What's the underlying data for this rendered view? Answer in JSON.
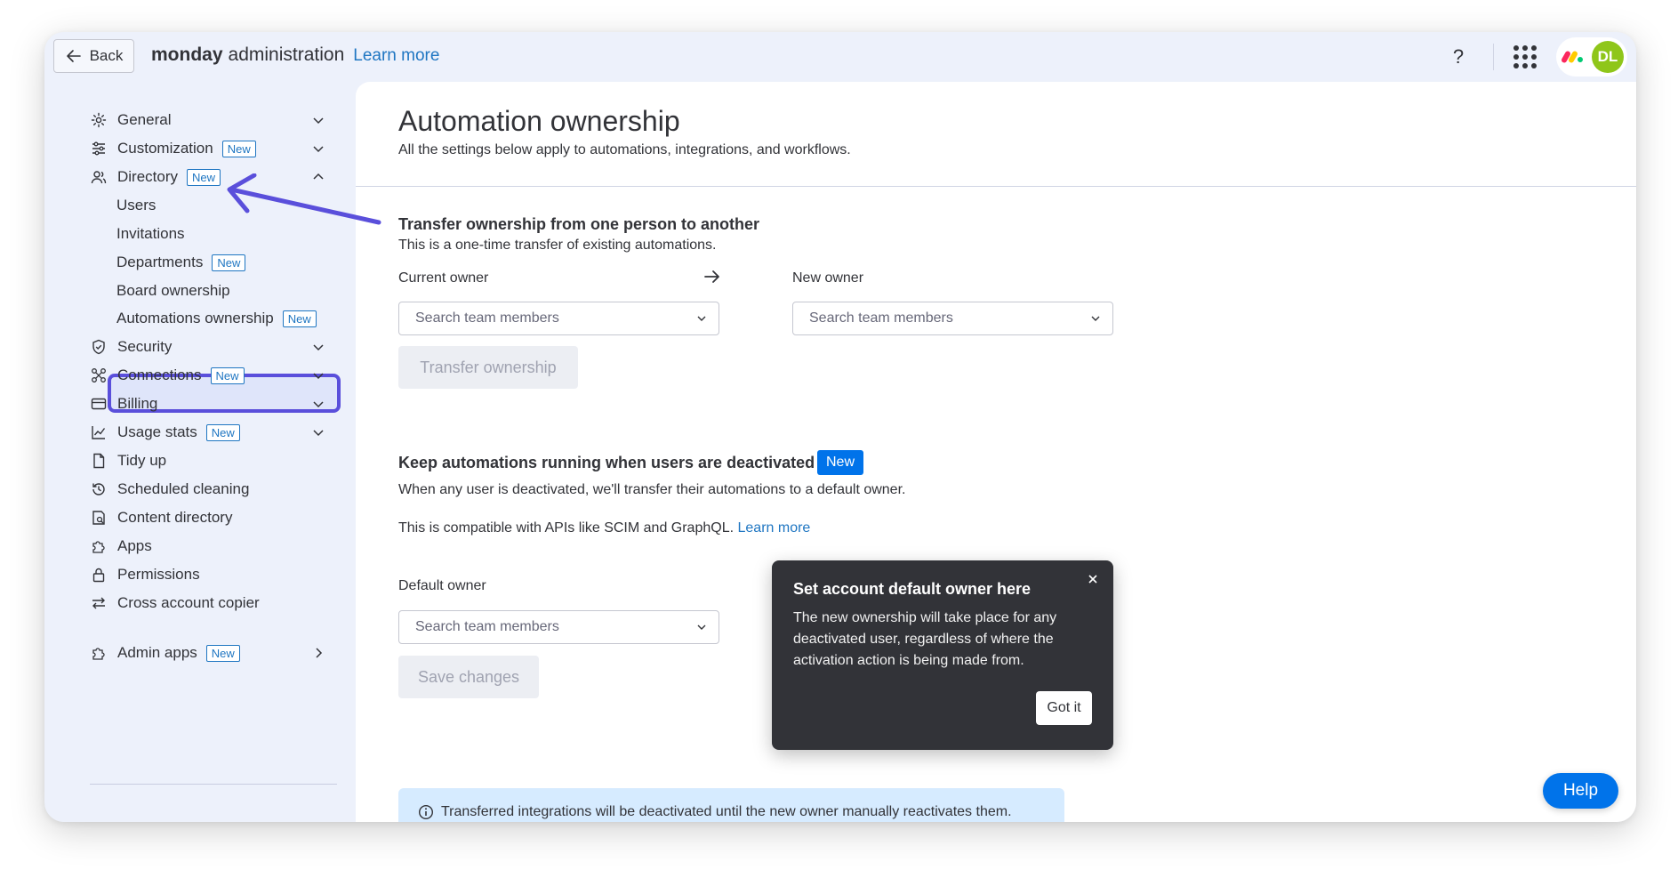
{
  "topbar": {
    "back_label": "Back",
    "brand_bold": "monday",
    "brand_light": "administration",
    "learn_more": "Learn more",
    "help_glyph": "?",
    "avatar_initials": "DL"
  },
  "sidebar": {
    "items": [
      {
        "label": "General",
        "icon": "gear-icon"
      },
      {
        "label": "Customization",
        "badge": "New",
        "icon": "sliders-icon"
      },
      {
        "label": "Directory",
        "badge": "New",
        "icon": "users-icon"
      },
      {
        "label": "Security",
        "icon": "shield-icon"
      },
      {
        "label": "Connections",
        "badge": "New",
        "icon": "connections-icon"
      },
      {
        "label": "Billing",
        "icon": "card-icon"
      },
      {
        "label": "Usage stats",
        "badge": "New",
        "icon": "chart-icon"
      },
      {
        "label": "Tidy up",
        "icon": "document-icon"
      },
      {
        "label": "Scheduled cleaning",
        "icon": "history-icon"
      },
      {
        "label": "Content directory",
        "icon": "content-icon"
      },
      {
        "label": "Apps",
        "icon": "puzzle-icon"
      },
      {
        "label": "Permissions",
        "icon": "lock-icon"
      },
      {
        "label": "Cross account copier",
        "icon": "swap-icon"
      }
    ],
    "sub_items": [
      {
        "label": "Users"
      },
      {
        "label": "Invitations"
      },
      {
        "label": "Departments",
        "badge": "New"
      },
      {
        "label": "Board ownership"
      },
      {
        "label": "Automations ownership",
        "badge": "New"
      }
    ],
    "admin_apps": {
      "label": "Admin apps",
      "badge": "New"
    }
  },
  "main": {
    "title": "Automation ownership",
    "subtitle": "All the settings below apply to automations, integrations, and workflows.",
    "transfer": {
      "title": "Transfer ownership from one person to another",
      "text": "This is a one-time transfer of existing automations.",
      "current_owner_label": "Current owner",
      "new_owner_label": "New owner",
      "search_placeholder": "Search team members",
      "button": "Transfer ownership"
    },
    "keep": {
      "title": "Keep automations running when users are deactivated",
      "badge": "New",
      "text1": "When any user is deactivated, we'll transfer their automations to a default owner.",
      "text2": "This is compatible with APIs like SCIM and GraphQL.",
      "learn_more": "Learn more",
      "default_owner_label": "Default owner",
      "search_placeholder": "Search team members",
      "button": "Save changes"
    },
    "info_banner": "Transferred integrations will be deactivated until the new owner manually reactivates them."
  },
  "tooltip": {
    "title": "Set account default owner here",
    "body": "The new ownership will take place for any deactivated user, regardless of where the activation action is being made from.",
    "button": "Got it"
  },
  "help_button": "Help",
  "colors": {
    "accent": "#0073ea",
    "annotation": "#5a4fdb",
    "avatar": "#8fc61a",
    "tooltip_bg": "#323338"
  }
}
